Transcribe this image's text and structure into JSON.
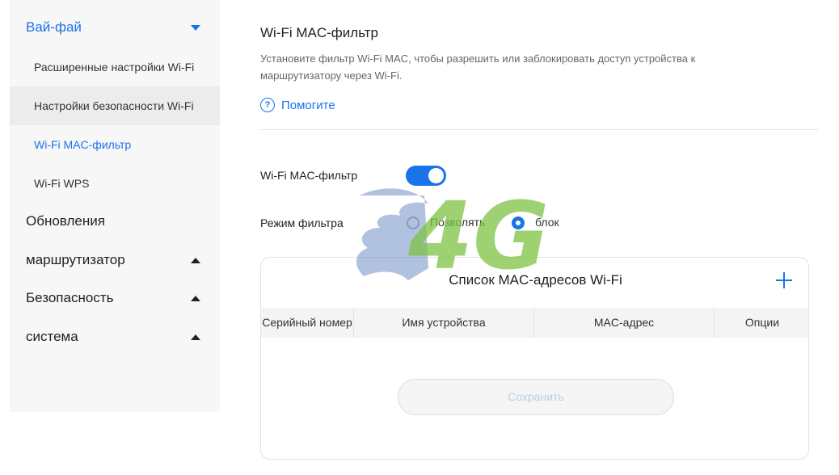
{
  "sidebar": {
    "wifi": {
      "label": "Вай-фай"
    },
    "sub_items": [
      {
        "label": "Расширенные настройки Wi-Fi"
      },
      {
        "label": "Настройки безопасности Wi-Fi"
      },
      {
        "label": "Wi-Fi MAC-фильтр"
      },
      {
        "label": "Wi-Fi WPS"
      }
    ],
    "groups": [
      {
        "label": "Обновления"
      },
      {
        "label": "маршрутизатор"
      },
      {
        "label": "Безопасность"
      },
      {
        "label": "система"
      }
    ]
  },
  "main": {
    "title": "Wi-Fi MAC-фильтр",
    "description": "Установите фильтр Wi-Fi MAC, чтобы разрешить или заблокировать доступ устройства к маршрутизатору через Wi-Fi.",
    "help_label": "Помогите",
    "help_icon_glyph": "?",
    "mac_filter_label": "Wi-Fi MAC-фильтр",
    "mac_filter_enabled": true,
    "filter_mode_label": "Режим фильтра",
    "filter_mode_options": [
      "Позволять",
      "блок"
    ],
    "filter_mode_selected": "блок",
    "list": {
      "title": "Список MAC-адресов Wi-Fi",
      "columns": [
        "Серийный номер",
        "Имя устройства",
        "MAC-адрес",
        "Опции"
      ],
      "rows": []
    },
    "save_label": "Сохранить"
  },
  "watermark": {
    "text": "4G"
  },
  "colors": {
    "accent": "#1a73e8",
    "watermark_green": "#7dc242",
    "watermark_blue": "#6f8fc4"
  }
}
